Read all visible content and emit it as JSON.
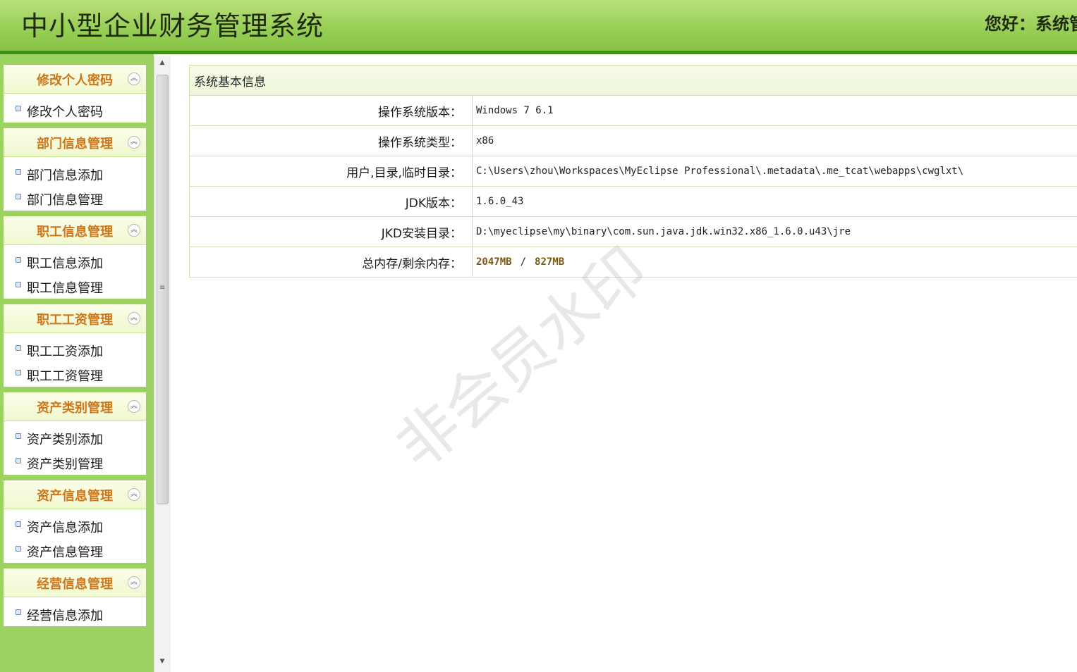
{
  "header": {
    "app_title": "中小型企业财务管理系统",
    "greeting": "您好：系统管"
  },
  "sidebar": {
    "groups": [
      {
        "title": "修改个人密码",
        "items": [
          "修改个人密码"
        ]
      },
      {
        "title": "部门信息管理",
        "items": [
          "部门信息添加",
          "部门信息管理"
        ]
      },
      {
        "title": "职工信息管理",
        "items": [
          "职工信息添加",
          "职工信息管理"
        ]
      },
      {
        "title": "职工工资管理",
        "items": [
          "职工工资添加",
          "职工工资管理"
        ]
      },
      {
        "title": "资产类别管理",
        "items": [
          "资产类别添加",
          "资产类别管理"
        ]
      },
      {
        "title": "资产信息管理",
        "items": [
          "资产信息添加",
          "资产信息管理"
        ]
      },
      {
        "title": "经营信息管理",
        "items": [
          "经营信息添加"
        ]
      }
    ],
    "collapse_icon": "chevron-up-icon"
  },
  "system_info": {
    "title": "系统基本信息",
    "rows": [
      {
        "label": "操作系统版本：",
        "value": "Windows 7  6.1"
      },
      {
        "label": "操作系统类型：",
        "value": "x86"
      },
      {
        "label": "用户,目录,临时目录：",
        "value": "C:\\Users\\zhou\\Workspaces\\MyEclipse Professional\\.metadata\\.me_tcat\\webapps\\cwglxt\\"
      },
      {
        "label": "JDK版本：",
        "value": "1.6.0_43"
      },
      {
        "label": "JKD安装目录：",
        "value": "D:\\myeclipse\\my\\binary\\com.sun.java.jdk.win32.x86_1.6.0.u43\\jre"
      }
    ],
    "memory": {
      "label": "总内存/剩余内存：",
      "total": "2047MB",
      "separator": "/",
      "free": "827MB"
    }
  },
  "watermark": "非会员水印",
  "colors": {
    "header_green": "#99cf57",
    "header_line": "#3f8f12",
    "sidebar_bg": "#9cd25f",
    "group_title": "#d07618"
  }
}
